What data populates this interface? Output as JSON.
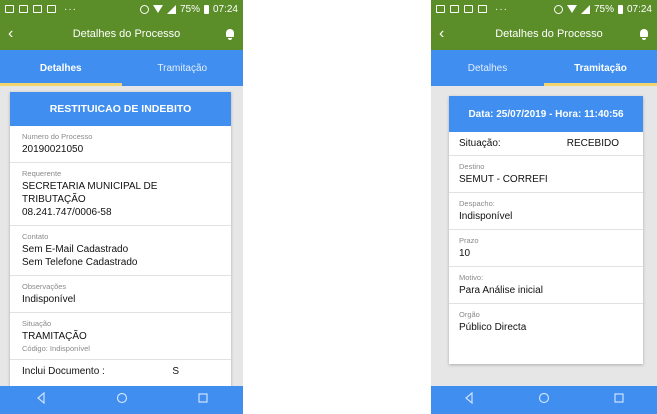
{
  "left_screen": {
    "status": {
      "battery": "75%",
      "time": "07:24"
    },
    "appbar": {
      "title": "Detalhes do Processo"
    },
    "tabs": [
      {
        "label": "Detalhes",
        "active": true
      },
      {
        "label": "Tramitação",
        "active": false
      }
    ],
    "card_title": "RESTITUICAO DE INDEBITO",
    "fields": {
      "numero": {
        "label": "Numero do Processo",
        "value": "20190021050"
      },
      "requerente": {
        "label": "Requerente",
        "value": "SECRETARIA MUNICIPAL DE TRIBUTAÇÃO",
        "value2": "08.241.747/0006-58"
      },
      "contato": {
        "label": "Contato",
        "value": "Sem E-Mail Cadastrado",
        "value2": "Sem Telefone Cadastrado"
      },
      "observacoes": {
        "label": "Observações",
        "value": "Indisponível"
      },
      "situacao": {
        "label": "Situação",
        "value": "TRAMITAÇÃO",
        "sub": "Código: Indisponível"
      },
      "inclui": {
        "label": "Inclui Documento :",
        "value": "S"
      }
    }
  },
  "right_screen": {
    "status": {
      "battery": "75%",
      "time": "07:24"
    },
    "appbar": {
      "title": "Detalhes do Processo"
    },
    "tabs": [
      {
        "label": "Detalhes",
        "active": false
      },
      {
        "label": "Tramitação",
        "active": true
      }
    ],
    "card_title": "Data: 25/07/2019 - Hora: 11:40:56",
    "fields": {
      "situacao": {
        "label": "Situação:",
        "value": "RECEBIDO"
      },
      "destino": {
        "label": "Destino",
        "value": "SEMUT - CORREFI"
      },
      "despacho": {
        "label": "Despacho:",
        "value": "Indisponível"
      },
      "prazo": {
        "label": "Prazo",
        "value": "10"
      },
      "motivo": {
        "label": "Motivo:",
        "value": "Para Análise inicial"
      },
      "orgao": {
        "label": "Orgão",
        "value": "Público Directa"
      }
    }
  },
  "colors": {
    "appbar": "#5b8d29",
    "tabs": "#3f8ef0",
    "tab_indicator": "#f3d36b",
    "nav": "#3f8ef0"
  },
  "icons": [
    "back-arrow-icon",
    "bell-icon",
    "nav-back-icon",
    "nav-home-icon",
    "nav-recent-icon"
  ]
}
